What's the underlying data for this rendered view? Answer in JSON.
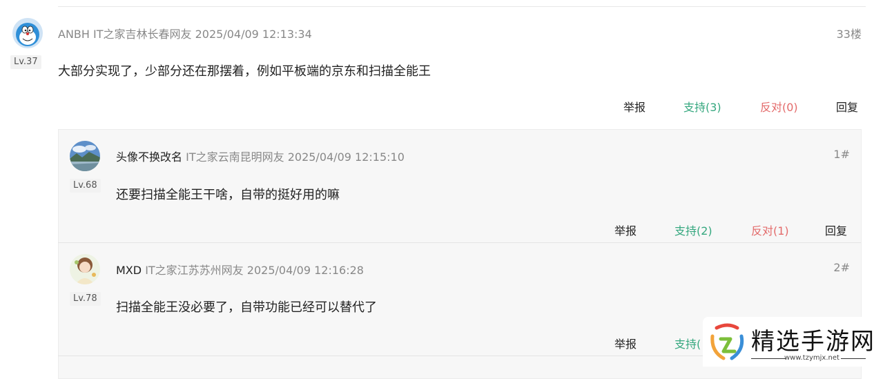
{
  "comment": {
    "nickname": "ANBH",
    "location": "IT之家吉林长春网友",
    "time": "2025/04/09 12:13:34",
    "floor": "33楼",
    "level": "Lv.37",
    "content": "大部分实现了，少部分还在那摆着，例如平板端的京东和扫描全能王",
    "report": "举报",
    "support": "支持(3)",
    "oppose": "反对(0)",
    "reply": "回复"
  },
  "replies": [
    {
      "nickname": "头像不换改名",
      "location": "IT之家云南昆明网友",
      "time": "2025/04/09 12:15:10",
      "floor": "1#",
      "level": "Lv.68",
      "content": "还要扫描全能王干啥，自带的挺好用的嘛",
      "report": "举报",
      "support": "支持(2)",
      "oppose": "反对(1)",
      "reply": "回复"
    },
    {
      "nickname": "MXD",
      "location": "IT之家江苏苏州网友",
      "time": "2025/04/09 12:16:28",
      "floor": "2#",
      "level": "Lv.78",
      "content": "扫描全能王没必要了，自带功能已经可以替代了",
      "report": "举报",
      "support": "支持("
    }
  ],
  "watermark": {
    "text": "精选手游网",
    "url": "www.tzymjx.net"
  },
  "colors": {
    "support": "#34a77e",
    "oppose": "#e36a6a",
    "meta": "#888888"
  }
}
